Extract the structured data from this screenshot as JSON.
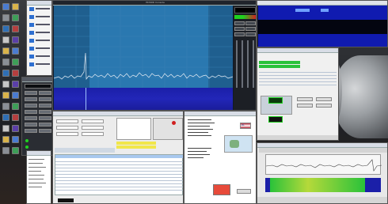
{
  "sdr_window": {
    "title": "HDSDR Console"
  },
  "flag_text": "ZL",
  "icon_names": [
    "radio-icon",
    "folder-icon",
    "settings-icon",
    "map-icon",
    "globe-icon",
    "volume-icon",
    "clock-icon",
    "waveform-icon"
  ],
  "colors": {
    "spectrum_bg": "#1f5f8f",
    "waterfall_bg": "#1b1fa8",
    "trace": "#e8eef5",
    "green_band": "#29c23a",
    "highlight_yellow": "#f1e64a",
    "led_green": "#1fd11f",
    "accent_red": "#d02020"
  }
}
